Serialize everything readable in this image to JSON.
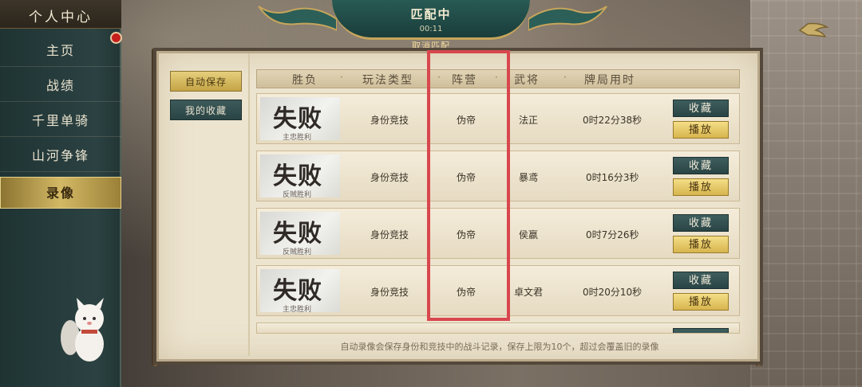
{
  "sidebar": {
    "title": "个人中心",
    "items": [
      {
        "label": "主页"
      },
      {
        "label": "战绩"
      },
      {
        "label": "千里单骑"
      },
      {
        "label": "山河争锋"
      },
      {
        "label": "录像"
      }
    ],
    "active_index": 4
  },
  "banner": {
    "title": "匹配中",
    "timer": "00:11",
    "cancel_label": "取消匹配"
  },
  "tabs": {
    "autosave": "自动保存",
    "favorites": "我的收藏"
  },
  "table": {
    "headers": [
      "胜负",
      "玩法类型",
      "阵营",
      "武将",
      "牌局用时"
    ],
    "separator": "·",
    "rows": [
      {
        "result": "失败",
        "sub": "主忠胜利",
        "mode": "身份竞技",
        "camp": "伪帝",
        "general": "法正",
        "duration": "0时22分38秒"
      },
      {
        "result": "失败",
        "sub": "反贼胜利",
        "mode": "身份竞技",
        "camp": "伪帝",
        "general": "暴鸢",
        "duration": "0时16分3秒"
      },
      {
        "result": "失败",
        "sub": "反贼胜利",
        "mode": "身份竞技",
        "camp": "伪帝",
        "general": "侯嬴",
        "duration": "0时7分26秒"
      },
      {
        "result": "失败",
        "sub": "主忠胜利",
        "mode": "身份竞技",
        "camp": "伪帝",
        "general": "卓文君",
        "duration": "0时20分10秒"
      }
    ],
    "fav_label": "收藏",
    "play_label": "播放"
  },
  "footer_note": "自动录像会保存身份和竞技中的战斗记录，保存上限为10个，超过会覆盖旧的录像",
  "colors": {
    "highlight": "#d8474e",
    "gold": "#d3b865",
    "teal": "#2c4242"
  }
}
